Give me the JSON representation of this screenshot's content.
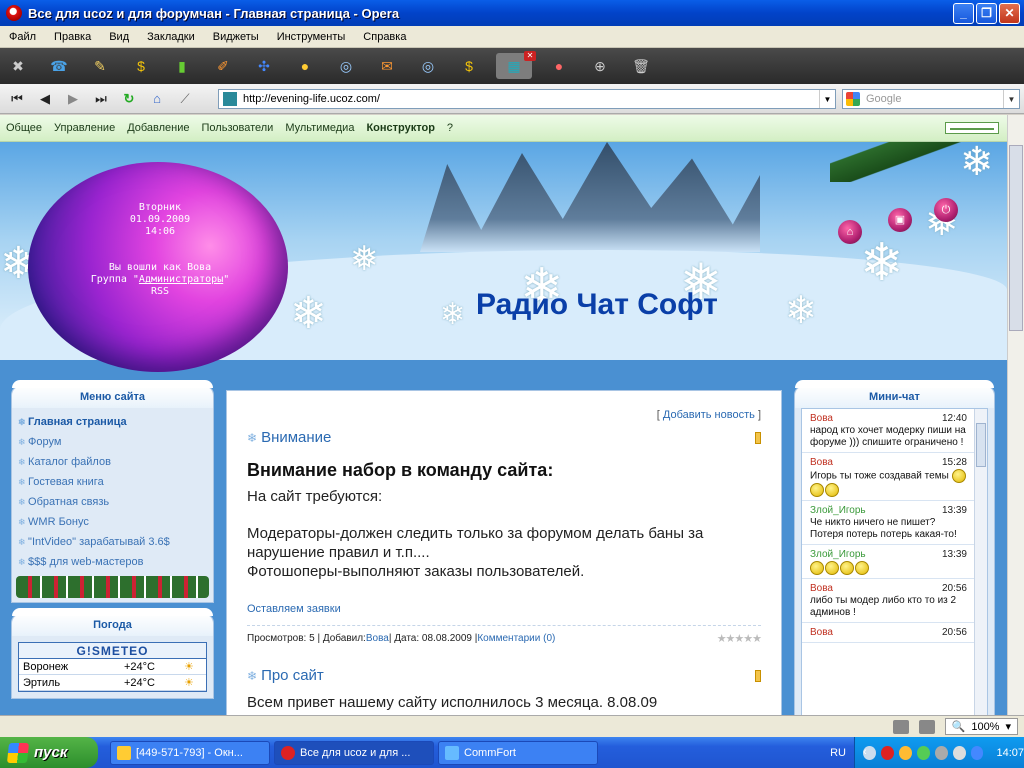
{
  "window": {
    "title": "Все для ucoz и для форумчан - Главная страница - Opera",
    "min": "_",
    "max": "❐",
    "close": "✕"
  },
  "menubar": [
    "Файл",
    "Правка",
    "Вид",
    "Закладки",
    "Виджеты",
    "Инструменты",
    "Справка"
  ],
  "tabs": [
    "tools",
    "page",
    "page",
    "page",
    "mail",
    "note",
    "page",
    "dollar",
    "chart",
    "pencil",
    "puzzle",
    "page",
    "page",
    "coin",
    "page",
    "flag",
    "envelope",
    "flag",
    "dollar",
    "page",
    "page",
    "active",
    "opera",
    "plus",
    "trash"
  ],
  "address": {
    "url": "http://evening-life.ucoz.com/",
    "search_placeholder": "Google"
  },
  "ucoz_panel": [
    "Общее",
    "Управление",
    "Добавление",
    "Пользователи",
    "Мультимедиа",
    "Конструктор",
    "?"
  ],
  "header": {
    "day": "Вторник",
    "date": "01.09.2009",
    "time": "14:06",
    "login_text": "Вы вошли как",
    "login_user": "Вова",
    "group_prefix": "Группа \"",
    "group_name": "Администраторы",
    "group_suffix": "\"",
    "rss": "RSS",
    "site_title": "Радио Чат Софт"
  },
  "left_menu": {
    "title": "Меню сайта",
    "items": [
      "Главная страница",
      "Форум",
      "Каталог файлов",
      "Гостевая книга",
      "Обратная связь",
      "WMR Бонус",
      "\"IntVideo\" зарабатывай 3.6$",
      "$$$ для web-мастеров"
    ]
  },
  "weather": {
    "title": "Погода",
    "logo": "G!SMETEO",
    "rows": [
      {
        "city": "Воронеж",
        "temp": "+24°C"
      },
      {
        "city": "Эртиль",
        "temp": "+24°C"
      }
    ]
  },
  "news": {
    "add_news": "Добавить новость",
    "bracket_l": "[",
    "bracket_r": "]",
    "section1": "Внимание",
    "title": "Внимание набор в команду сайта:",
    "line1": "На сайт требуются:",
    "line2": "Модераторы-должен следить только за форумом делать баны за нарушение правил и т.п....",
    "line3": "Фотошоперы-выполняют заказы пользователей.",
    "apply": "Оставляем заявки",
    "meta_views": "Просмотров: 5 | Добавил: ",
    "meta_author": "Вова",
    "meta_date": " | Дата: 08.08.2009 | ",
    "meta_comments": "Комментарии (0)",
    "stars": "★★★★★",
    "section2": "Про сайт",
    "cut_text": "Всем привет нашему сайту исполнилось 3 месяца. 8.08.09"
  },
  "minichat": {
    "title": "Мини-чат",
    "messages": [
      {
        "user": "Вова",
        "time": "12:40",
        "text": "народ кто хочет модерку пиши на форуме ))) спишите ограничено !",
        "green": false,
        "smiles": 0
      },
      {
        "user": "Вова",
        "time": "15:28",
        "text": "Игорь ты тоже создавай темы",
        "green": false,
        "smiles": 3
      },
      {
        "user": "Злой_Игорь",
        "time": "13:39",
        "text": "Че никто ничего не пишет? Потеря потерь потерь какая-то!",
        "green": true,
        "smiles": 0
      },
      {
        "user": "Злой_Игорь",
        "time": "13:39",
        "text": "",
        "green": true,
        "smiles": 4
      },
      {
        "user": "Вова",
        "time": "20:56",
        "text": "либо ты модер либо кто то из 2 админов !",
        "green": false,
        "smiles": 0
      },
      {
        "user": "Вова",
        "time": "20:56",
        "text": "",
        "green": false,
        "smiles": 0
      }
    ]
  },
  "statusbar": {
    "zoom": "100%"
  },
  "taskbar": {
    "start": "пуск",
    "tasks": [
      "[449-571-793] - Окн...",
      "Все для ucoz и для ...",
      "CommFort"
    ],
    "lang": "RU",
    "clock": "14:07"
  },
  "colors": {
    "accent": "#2b6ab2",
    "title_blue": "#0a3fa8",
    "header_sky": "#5aa6e4"
  }
}
